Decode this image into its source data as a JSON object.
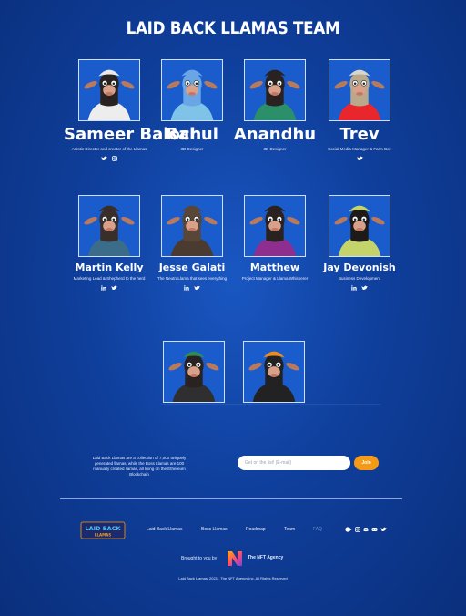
{
  "page": {
    "title": "LAID BACK LLAMAS TEAM"
  },
  "team": [
    {
      "name": "Sameer Baloch",
      "role": "Artistic Director and creator of the Llamas",
      "socials": [
        "twitter-icon",
        "instagram-icon"
      ],
      "hat_color": "#e9e9e9",
      "fur_color": "#2a2220",
      "body_color": "#ededed"
    },
    {
      "name": "Rahul",
      "role": "3D Designer",
      "socials": [],
      "hat_color": "#6aa6e6",
      "fur_color": "#6aa6e6",
      "body_color": "#7fc4e8"
    },
    {
      "name": "Anandhu",
      "role": "3D Designer",
      "socials": [],
      "hat_color": "#2a2220",
      "fur_color": "#2a2220",
      "body_color": "#2b8f6a"
    },
    {
      "name": "Trev",
      "role": "Social Media Manager & Farm Boy",
      "socials": [
        "twitter-icon"
      ],
      "hat_color": "#d8d4c8",
      "fur_color": "#b9a889",
      "body_color": "#e8262c"
    },
    {
      "name": "Martin Kelly",
      "role": "Marketing Lead & Shepherd to the herd",
      "socials": [
        "linkedin-icon",
        "twitter-icon"
      ],
      "hat_color": "#3a2e2a",
      "fur_color": "#3a2e2a",
      "body_color": "#3b6c8a"
    },
    {
      "name": "Jesse Galati",
      "role": "The NeutraLlama that sees everything",
      "socials": [
        "linkedin-icon",
        "twitter-icon"
      ],
      "hat_color": "#5a4636",
      "fur_color": "#5a4636",
      "body_color": "#4a3a30"
    },
    {
      "name": "Matthew",
      "role": "Project Manager & Llama Whisperer",
      "socials": [],
      "hat_color": "#2a2220",
      "fur_color": "#2a2220",
      "body_color": "#8e2f8f"
    },
    {
      "name": "Jay Devonish",
      "role": "Business Development",
      "socials": [
        "linkedin-icon",
        "twitter-icon"
      ],
      "hat_color": "#c5d46a",
      "fur_color": "#1e1a18",
      "body_color": "#c5d46a"
    },
    {
      "name": "",
      "role": "",
      "socials": [],
      "hat_color": "#2e8b57",
      "fur_color": "#2a2220",
      "body_color": "#2f2f2f"
    },
    {
      "name": "",
      "role": "",
      "socials": [],
      "hat_color": "#f08a1c",
      "fur_color": "#222",
      "body_color": "#222"
    }
  ],
  "newsletter": {
    "about": "Laid Back Llamas are a collection of 7,000 uniquely generated llamas, while the Boss Llamas are 100 manually created llamas, all living on the Ethereum Blockchain",
    "email_placeholder": "Get on the list! (E-mail)",
    "join_label": "Join"
  },
  "footer": {
    "logo_text": "LAID BACK LLAMAS",
    "nav": [
      "Laid Back Llamas",
      "Boss Llamas",
      "Roadmap",
      "Team",
      "FAQ"
    ],
    "socials": [
      "opensea-icon",
      "instagram-icon",
      "discord-icon",
      "twitter-icon"
    ],
    "brought_by": "Brought to you by",
    "agency": "The NFT Agency",
    "copyright": "Laid Back Llamas. 2021 . The NFT Agency Inc. All Rights Reserved"
  },
  "colors": {
    "background": "#0f3f9c",
    "accent": "#f59a17"
  }
}
